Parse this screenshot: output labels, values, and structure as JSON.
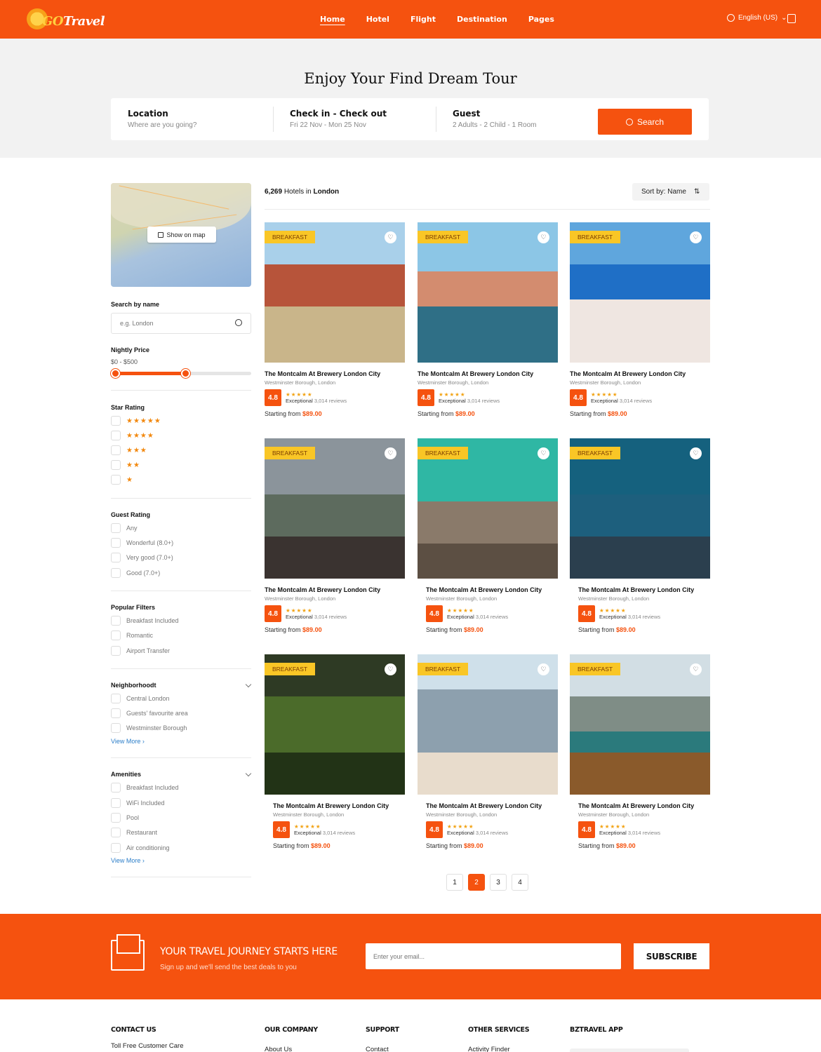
{
  "header": {
    "logo_go": "GO",
    "logo_text": "Travel",
    "nav": [
      "Home",
      "Hotel",
      "Flight",
      "Destination",
      "Pages"
    ],
    "active_nav": "Home",
    "language": "English (US)"
  },
  "hero": {
    "title": "Enjoy Your Find Dream Tour",
    "location_label": "Location",
    "location_value": "Where are you going?",
    "dates_label": "Check in - Check out",
    "dates_value": "Fri 22 Nov - Mon 25 Nov",
    "guest_label": "Guest",
    "guest_value": "2 Adults - 2 Child - 1 Room",
    "search_button": "Search"
  },
  "sidebar": {
    "map_button": "Show on map",
    "search_by_name": "Search by name",
    "name_placeholder": "e.g. London",
    "nightly_price": "Nightly Price",
    "price_range": "$0 - $500",
    "price_slider": {
      "min": 0,
      "max": 500,
      "from": 0,
      "to": 250
    },
    "star_rating": "Star Rating",
    "stars": [
      "★★★★★",
      "★★★★",
      "★★★",
      "★★",
      "★"
    ],
    "guest_rating": "Guest Rating",
    "guest_options": [
      "Any",
      "Wonderful (8.0+)",
      "Very good (7.0+)",
      "Good (7.0+)"
    ],
    "popular_filters": "Popular Filters",
    "popular_options": [
      "Breakfast Included",
      "Romantic",
      "Airport Transfer"
    ],
    "neighborhood": "Neighborhoodt",
    "neighborhood_options": [
      "Central London",
      "Guests' favourite area",
      "Westminster Borough"
    ],
    "amenities": "Amenities",
    "amenity_options": [
      "Breakfast Included",
      "WiFi Included",
      "Pool",
      "Restaurant",
      "Air conditioning"
    ],
    "view_more": "View More"
  },
  "results": {
    "count": "6,269",
    "in_text": "Hotels in",
    "city": "London",
    "sort_label": "Sort by: Name",
    "tag": "BREAKFAST",
    "card": {
      "title": "The Montcalm At Brewery London City",
      "location": "Westminster Borough, London",
      "score": "4.8",
      "stars": "★★★★★",
      "rating_word": "Exceptional",
      "reviews": "3,014 reviews",
      "price_prefix": "Starting from",
      "price": "$89.00"
    },
    "pages": [
      "1",
      "2",
      "3",
      "4"
    ],
    "active_page": "2"
  },
  "newsletter": {
    "title": "YOUR TRAVEL JOURNEY STARTS HERE",
    "subtitle": "Sign up and we'll send the best deals to you",
    "email_placeholder": "Enter your email...",
    "button": "SUBSCRIBE"
  },
  "footer": {
    "contact": "CONTACT US",
    "contact_item": "Toll Free Customer Care",
    "company": "OUR COMPANY",
    "company_item": "About Us",
    "support": "SUPPORT",
    "support_item": "Contact",
    "services": "OTHER SERVICES",
    "services_item": "Activity Finder",
    "app": "BZTRAVEL APP"
  },
  "colors": {
    "brand": "#f5520f",
    "tag": "#f9c626",
    "stars": "#f2a314",
    "link": "#2c7ec9"
  }
}
